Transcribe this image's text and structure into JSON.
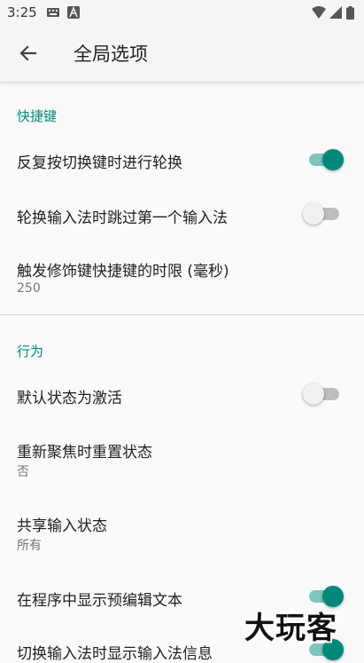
{
  "status_bar": {
    "time": "3:25",
    "icons": [
      "keyboard-icon",
      "a-notification-icon",
      "wifi-icon",
      "signal-icon",
      "battery-icon"
    ]
  },
  "app_bar": {
    "title": "全局选项",
    "back_icon": "arrow-back-icon"
  },
  "sections": {
    "shortcuts": {
      "header": "快捷键",
      "items": [
        {
          "title": "反复按切换键时进行轮换",
          "switch_on": true
        },
        {
          "title": "轮换输入法时跳过第一个输入法",
          "switch_on": false
        },
        {
          "title": "触发修饰键快捷键的时限 (毫秒)",
          "summary": "250"
        }
      ]
    },
    "behavior": {
      "header": "行为",
      "items": [
        {
          "title": "默认状态为激活",
          "switch_on": false
        },
        {
          "title": "重新聚焦时重置状态",
          "summary": "否"
        },
        {
          "title": "共享输入状态",
          "summary": "所有"
        },
        {
          "title": "在程序中显示预编辑文本",
          "switch_on": true
        },
        {
          "title": "切换输入法时显示输入法信息",
          "switch_on": true
        }
      ]
    }
  },
  "watermark": "大玩客",
  "colors": {
    "accent": "#00897b",
    "background": "#fafafa",
    "app_bar": "#f5f5f5"
  }
}
